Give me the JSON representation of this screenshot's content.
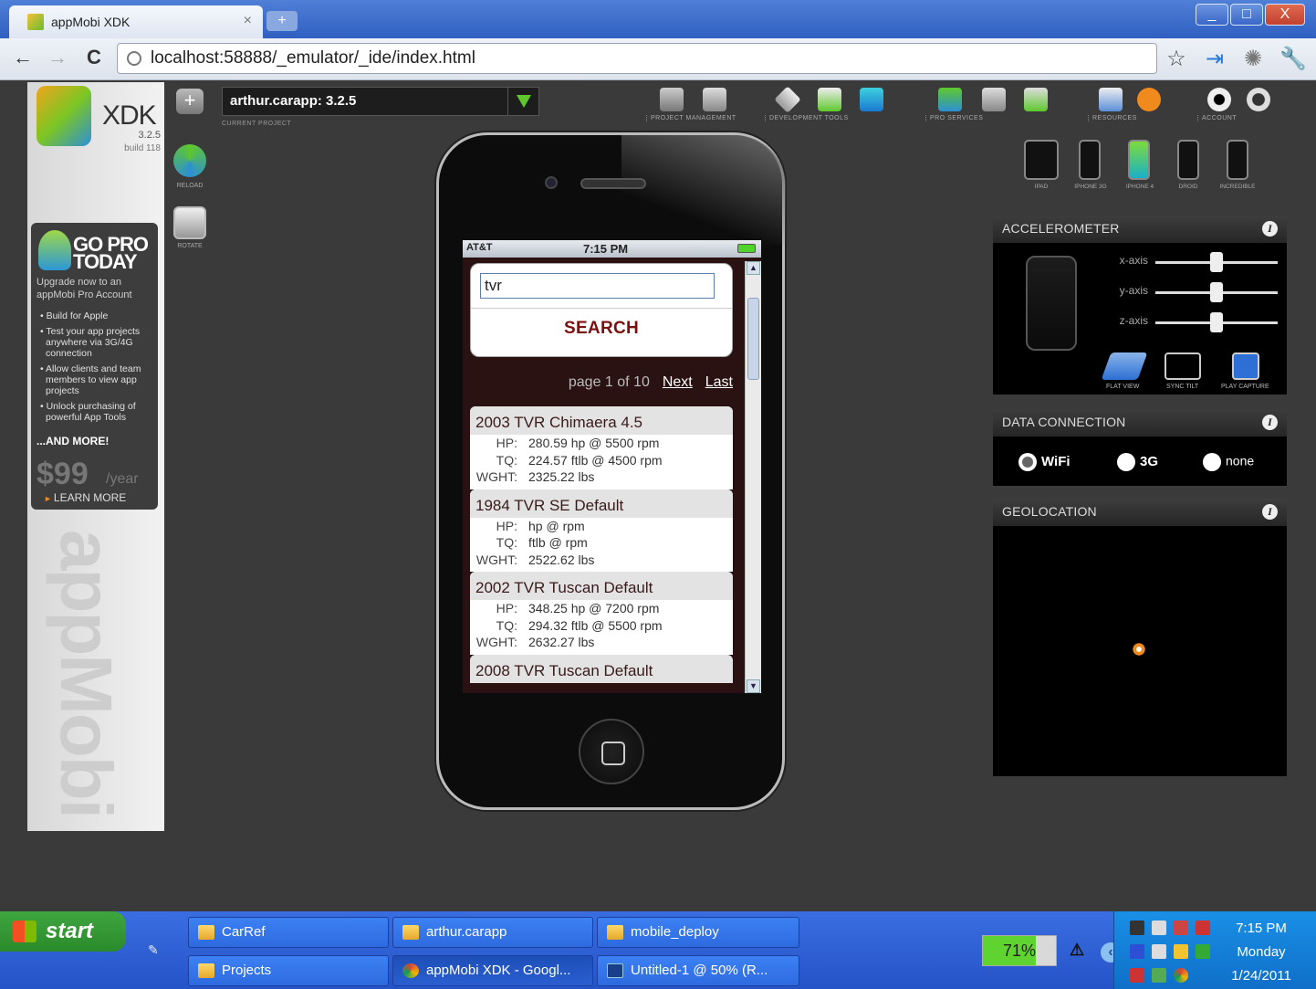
{
  "browser": {
    "tab_title": "appMobi XDK",
    "tab_close": "×",
    "new_tab": "+",
    "url": "localhost:58888/_emulator/_ide/index.html",
    "window_controls": [
      "_",
      "□",
      "X"
    ]
  },
  "xdk": {
    "brand": "XDK",
    "version": "3.2.5",
    "build": "build 118",
    "project": {
      "value": "arthur.carapp: 3.2.5",
      "label": "CURRENT PROJECT"
    },
    "tools": [
      {
        "name": "reload-button",
        "label": "RELOAD"
      },
      {
        "name": "rotate-button",
        "label": "ROTATE"
      }
    ],
    "top_groups": [
      {
        "label": "PROJECT MANAGEMENT"
      },
      {
        "label": "DEVELOPMENT TOOLS"
      },
      {
        "label": "PRO SERVICES"
      },
      {
        "label": "RESOURCES"
      },
      {
        "label": "ACCOUNT"
      }
    ],
    "devices": [
      "IPAD",
      "IPHONE 3G",
      "IPHONE 4",
      "DROID",
      "INCREDIBLE"
    ]
  },
  "promo": {
    "heading1": "GO PRO",
    "heading2": "TODAY",
    "sub": "Upgrade now to an appMobi Pro Account",
    "bullets": [
      "Build for Apple",
      "Test your app projects anywhere via 3G/4G connection",
      "Allow clients and team members to view app projects",
      "Unlock purchasing of powerful App Tools"
    ],
    "more": "...AND MORE!",
    "price": "$99",
    "per": "/year",
    "learn": "LEARN MORE",
    "watermark": "appMobi"
  },
  "phone": {
    "carrier": "AT&T",
    "time": "7:15 PM",
    "search_value": "tvr",
    "search_button": "SEARCH",
    "pager": {
      "text": "page 1 of 10",
      "next": "Next",
      "last": "Last"
    },
    "results": [
      {
        "title": "2003 TVR Chimaera 4.5",
        "hp": "280.59 hp @ 5500 rpm",
        "tq": "224.57 ftlb @ 4500 rpm",
        "wght": "2325.22 lbs"
      },
      {
        "title": "1984 TVR SE Default",
        "hp": "hp @ rpm",
        "tq": "ftlb @ rpm",
        "wght": "2522.62 lbs"
      },
      {
        "title": "2002 TVR Tuscan Default",
        "hp": "348.25 hp @ 7200 rpm",
        "tq": "294.32 ftlb @ 5500 rpm",
        "wght": "2632.27 lbs"
      },
      {
        "title": "2008 TVR Tuscan Default",
        "hp": "",
        "tq": "",
        "wght": ""
      }
    ],
    "spec_labels": {
      "hp": "HP:",
      "tq": "TQ:",
      "wght": "WGHT:"
    }
  },
  "panels": {
    "accelerometer": {
      "title": "ACCELEROMETER",
      "axes": [
        "x-axis",
        "y-axis",
        "z-axis"
      ],
      "buttons": [
        "FLAT VIEW",
        "SYNC TILT",
        "PLAY CAPTURE"
      ]
    },
    "data_connection": {
      "title": "DATA CONNECTION",
      "options": [
        "WiFi",
        "3G",
        "none"
      ],
      "selected": "WiFi"
    },
    "geolocation": {
      "title": "GEOLOCATION"
    },
    "info_glyph": "i"
  },
  "taskbar": {
    "start": "start",
    "tasks": [
      {
        "label": "CarRef"
      },
      {
        "label": "arthur.carapp"
      },
      {
        "label": "mobile_deploy"
      },
      {
        "label": "Projects"
      },
      {
        "label": "appMobi XDK - Googl..."
      },
      {
        "label": "Untitled-1 @ 50% (R..."
      }
    ],
    "battery": "71%",
    "clock": {
      "time": "7:15 PM",
      "day": "Monday",
      "date": "1/24/2011"
    }
  },
  "colors": {
    "accent_green": "#5ec82c",
    "search_red": "#7a1010",
    "taskbar_blue": "#2e6ae0"
  }
}
